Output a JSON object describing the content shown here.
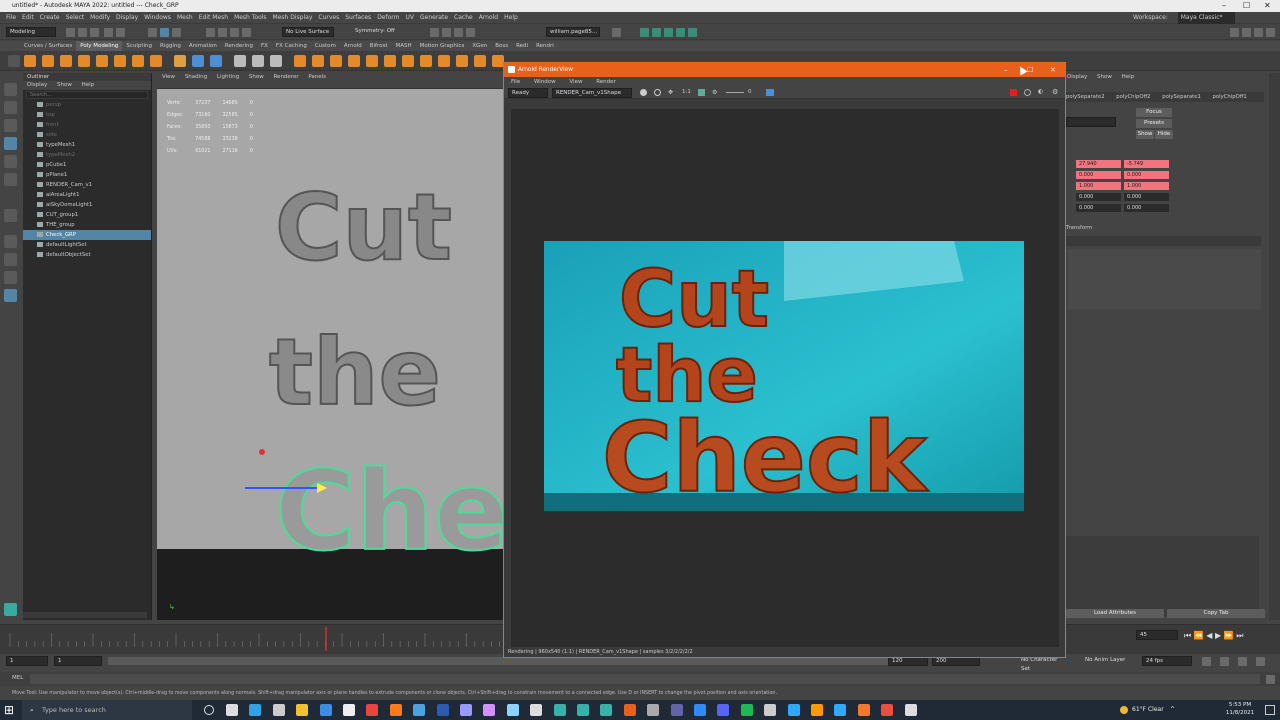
{
  "window": {
    "title": "untitled* - Autodesk MAYA 2022: untitled  ---  Check_GRP",
    "workspace_label": "Workspace:",
    "workspace_value": "Maya Classic*"
  },
  "menubar": [
    "File",
    "Edit",
    "Create",
    "Select",
    "Modify",
    "Display",
    "Windows",
    "Mesh",
    "Edit Mesh",
    "Mesh Tools",
    "Mesh Display",
    "Curves",
    "Surfaces",
    "Deform",
    "UV",
    "Generate",
    "Cache",
    "Arnold",
    "Help"
  ],
  "statusline": {
    "mode": "Modeling",
    "live_surface": "No Live Surface",
    "symmetry": "Symmetry: Off",
    "project": "william.page85..."
  },
  "shelf_tabs": [
    "Curves / Surfaces",
    "Poly Modeling",
    "Sculpting",
    "Rigging",
    "Animation",
    "Rendering",
    "FX",
    "FX Caching",
    "Custom",
    "Arnold",
    "Bifrost",
    "MASH",
    "Motion Graphics",
    "XGen",
    "Boss",
    "Redi",
    "Rendri"
  ],
  "shelf_active": "Poly Modeling",
  "outliner": {
    "title": "Outliner",
    "menu": [
      "Display",
      "Show",
      "Help"
    ],
    "search_placeholder": "Search...",
    "items": [
      {
        "label": "persp",
        "state": "dim"
      },
      {
        "label": "top",
        "state": "dim"
      },
      {
        "label": "front",
        "state": "dim"
      },
      {
        "label": "side",
        "state": "dim"
      },
      {
        "label": "typeMesh1",
        "state": "normal"
      },
      {
        "label": "typeMesh2",
        "state": "dim"
      },
      {
        "label": "pCube1",
        "state": "normal"
      },
      {
        "label": "pPlane1",
        "state": "normal"
      },
      {
        "label": "RENDER_Cam_v1",
        "state": "normal"
      },
      {
        "label": "aiAreaLight1",
        "state": "normal"
      },
      {
        "label": "aiSkyDomeLight1",
        "state": "normal"
      },
      {
        "label": "CUT_group1",
        "state": "normal"
      },
      {
        "label": "THE_group",
        "state": "normal"
      },
      {
        "label": "Check_GRP",
        "state": "selected"
      },
      {
        "label": "defaultLightSet",
        "state": "normal"
      },
      {
        "label": "defaultObjectSet",
        "state": "normal"
      }
    ]
  },
  "viewport": {
    "menu": [
      "View",
      "Shading",
      "Lighting",
      "Show",
      "Renderer",
      "Panels"
    ],
    "hud": [
      {
        "label": "Verts:",
        "a": "37237",
        "b": "14685",
        "c": "0"
      },
      {
        "label": "Edges:",
        "a": "73160",
        "b": "32585",
        "c": "0"
      },
      {
        "label": "Faces:",
        "a": "35850",
        "b": "15873",
        "c": "0"
      },
      {
        "label": "Tris:",
        "a": "74588",
        "b": "33238",
        "c": "0"
      },
      {
        "label": "UVs:",
        "a": "61021",
        "b": "27116",
        "c": "0"
      }
    ],
    "scene_text": [
      "Cut",
      "the",
      "Check"
    ]
  },
  "render_view": {
    "title": "Arnold RenderView",
    "menu": [
      "File",
      "Window",
      "View",
      "Render"
    ],
    "status_dropdown": "Ready",
    "camera_dropdown": "RENDER_Cam_v1Shape",
    "ratio": "1:1",
    "exposure": "0",
    "render_text": [
      "Cut",
      "the",
      "Check"
    ],
    "status_line": "Rendering | 960x540 (1:1) | RENDER_Cam_v1Shape | samples 3/2/2/2/2/2"
  },
  "channel_box": {
    "menu": [
      "Display",
      "Show",
      "Help"
    ],
    "tabs": [
      "polySeparate2",
      "polyChipOff2",
      "polySeparate1",
      "polyChipOff1"
    ],
    "buttons": [
      "Focus",
      "Presets",
      "Show",
      "Hide"
    ],
    "rows": [
      {
        "a": "27.940",
        "b": "-5.749",
        "color": "red"
      },
      {
        "a": "0.000",
        "b": "0.000",
        "color": "red"
      },
      {
        "a": "1.000",
        "b": "1.000",
        "color": "red"
      },
      {
        "a": "0.000",
        "b": "0.000",
        "color": "gray"
      },
      {
        "a": "0.000",
        "b": "0.000",
        "color": "gray"
      }
    ],
    "section": "Transform",
    "load_attributes": "Load Attributes",
    "copy_tab": "Copy Tab"
  },
  "timeline": {
    "current_frame": "45",
    "start": "1",
    "start2": "1",
    "range_end": "120",
    "range_end2": "200",
    "character_set": "No Character Set",
    "anim_layer": "No Anim Layer",
    "fps": "24 fps"
  },
  "cmd": {
    "label": "MEL",
    "help": "Move Tool: Use manipulator to move object(s). Ctrl+middle-drag to move components along normals. Shift+drag manipulator axis or plane handles to extrude components or clone objects. Ctrl+Shift+drag to constrain movement to a connected edge. Use D or INSERT to change the pivot position and axis orientation."
  },
  "taskbar": {
    "search_placeholder": "Type here to search",
    "weather": "61°F  Clear",
    "time": "5:53 PM",
    "date": "11/8/2021"
  },
  "colors": {
    "render_title": "#e8601c",
    "selection": "#5285a6",
    "keyed_attr": "#f1747e",
    "render_bg": "#1fb2c6",
    "letters": "#b5431d"
  }
}
